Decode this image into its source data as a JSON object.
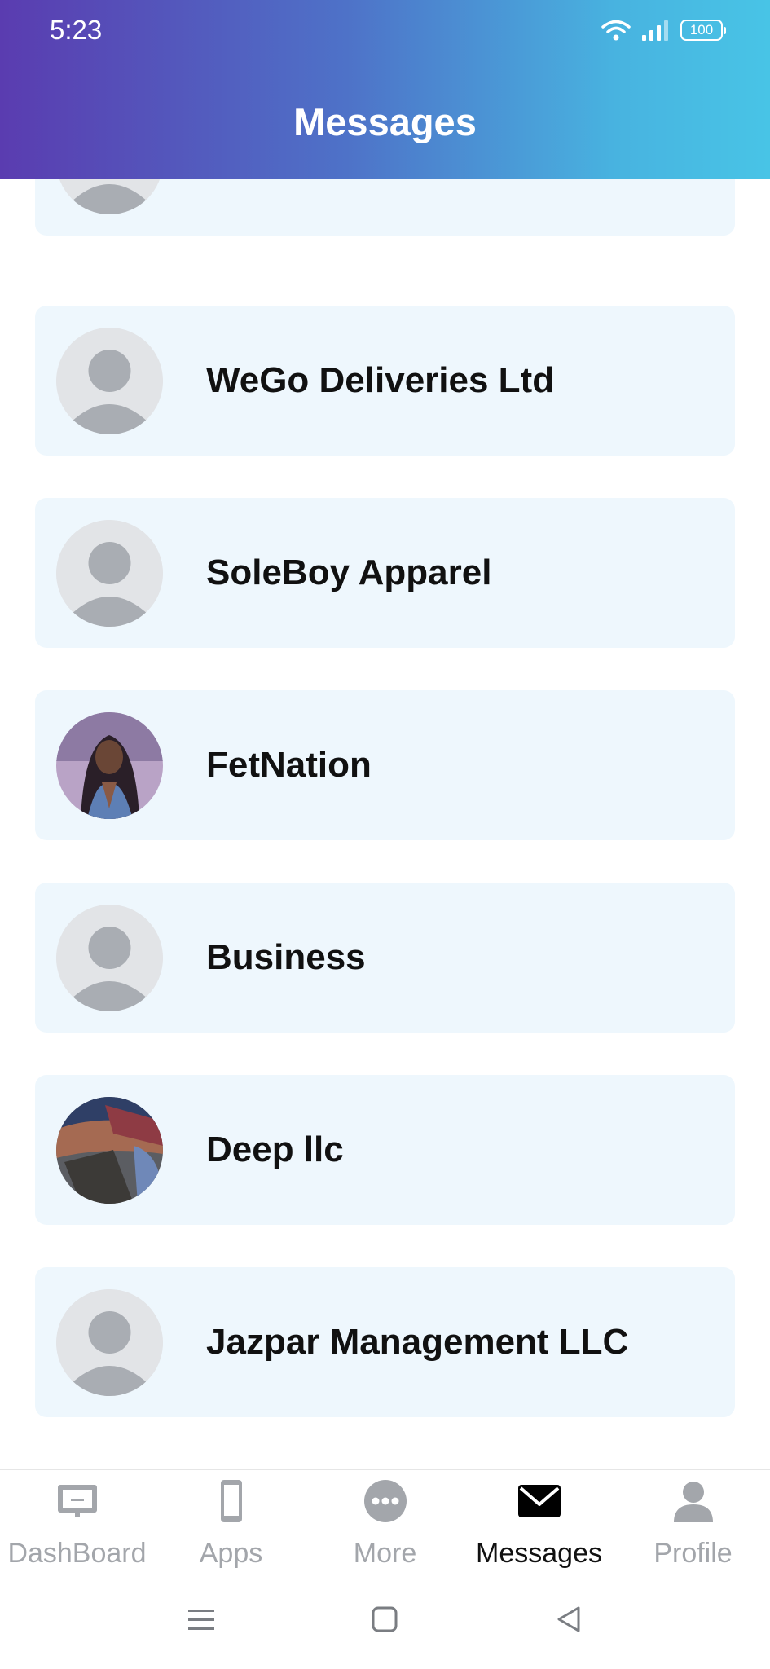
{
  "status_bar": {
    "time": "5:23",
    "battery": "100"
  },
  "header": {
    "title": "Messages"
  },
  "conversations": [
    {
      "name": "",
      "avatar": "default-avatar"
    },
    {
      "name": "WeGo Deliveries Ltd",
      "avatar": "default-avatar"
    },
    {
      "name": "SoleBoy Apparel",
      "avatar": "default-avatar"
    },
    {
      "name": "FetNation",
      "avatar": "photo-avatar"
    },
    {
      "name": "Business",
      "avatar": "default-avatar"
    },
    {
      "name": "Deep llc",
      "avatar": "photo-avatar"
    },
    {
      "name": "Jazpar Management LLC",
      "avatar": "default-avatar"
    }
  ],
  "tabs": [
    {
      "label": "DashBoard",
      "icon": "monitor-icon",
      "active": false
    },
    {
      "label": "Apps",
      "icon": "phone-icon",
      "active": false
    },
    {
      "label": "More",
      "icon": "more-icon",
      "active": false
    },
    {
      "label": "Messages",
      "icon": "mail-icon",
      "active": true
    },
    {
      "label": "Profile",
      "icon": "profile-icon",
      "active": false
    }
  ],
  "colors": {
    "header_gradient_start": "#5a3cb0",
    "header_gradient_end": "#48c4e6",
    "card_background": "#eef7fd",
    "inactive_tab": "#a3a6ab",
    "active_tab": "#111111"
  }
}
